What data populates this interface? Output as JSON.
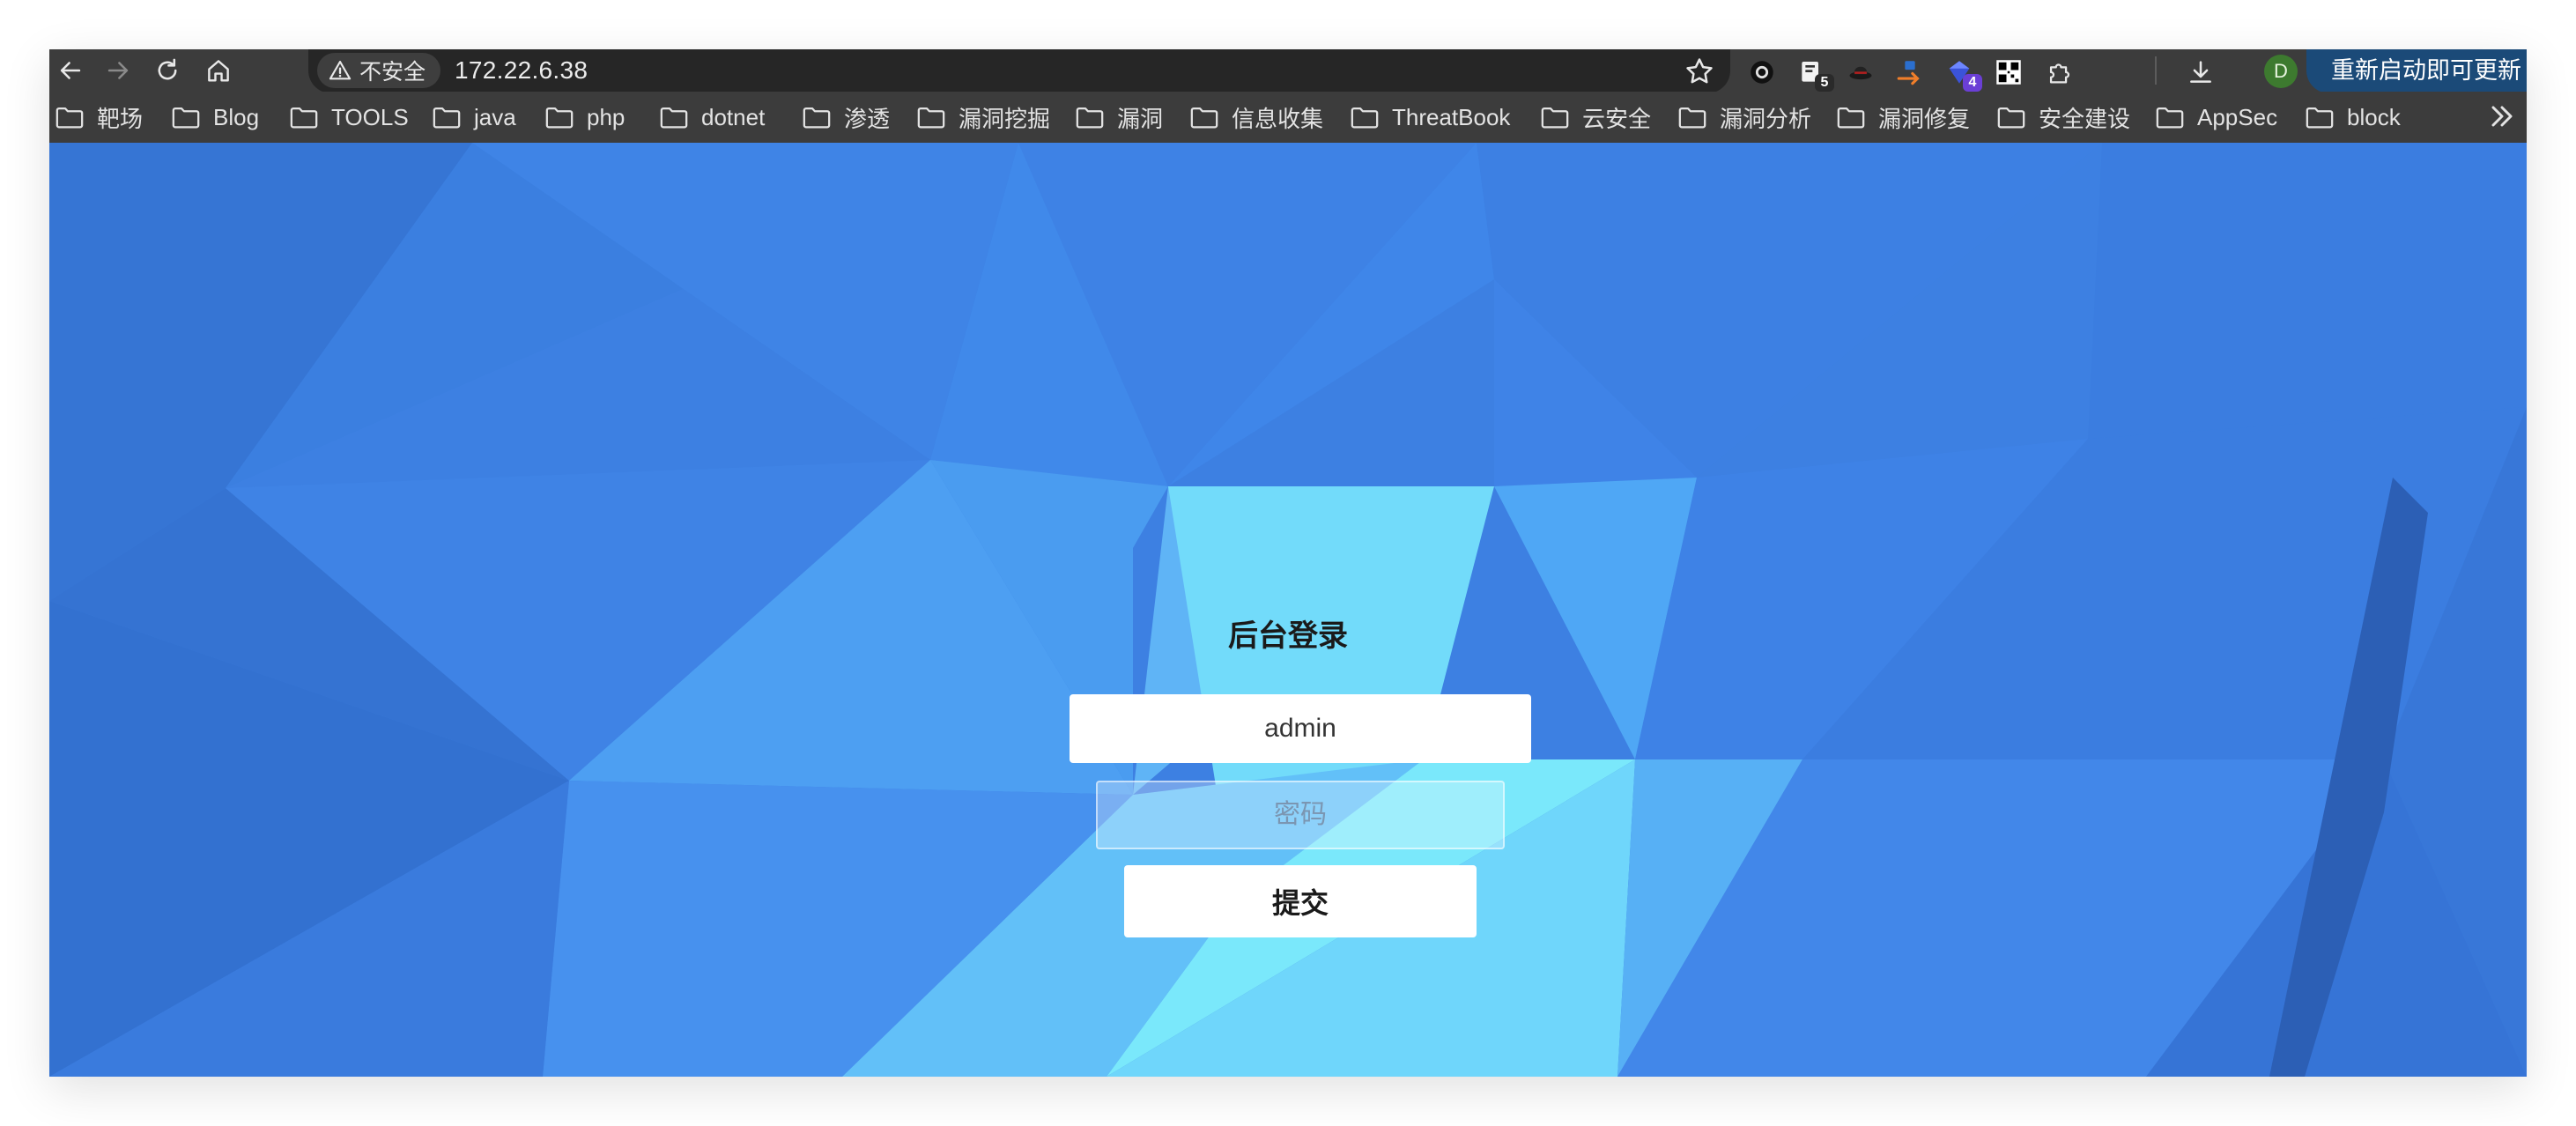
{
  "browser": {
    "security_label": "不安全",
    "url": "172.22.6.38",
    "extensions": [
      {
        "icon": "circle-record-extension-icon"
      },
      {
        "icon": "clipboard-extension-icon",
        "badge": "5",
        "badge_color": "#2a2a2a"
      },
      {
        "icon": "hat-extension-icon"
      },
      {
        "icon": "arrow-extension-icon",
        "color": "#f07e2a"
      },
      {
        "icon": "gem-extension-icon",
        "badge": "4",
        "badge_color": "#6b3fd6"
      },
      {
        "icon": "qr-extension-icon"
      },
      {
        "icon": "puzzle-extensions-icon"
      }
    ],
    "avatar_letter": "D",
    "update_label": "重新启动即可更新"
  },
  "bookmarks": [
    {
      "label": "靶场"
    },
    {
      "label": "Blog"
    },
    {
      "label": "TOOLS"
    },
    {
      "label": "java"
    },
    {
      "label": "php"
    },
    {
      "label": "dotnet"
    },
    {
      "label": "渗透"
    },
    {
      "label": "漏洞挖掘"
    },
    {
      "label": "漏洞"
    },
    {
      "label": "信息收集"
    },
    {
      "label": "ThreatBook"
    },
    {
      "label": "云安全"
    },
    {
      "label": "漏洞分析"
    },
    {
      "label": "漏洞修复"
    },
    {
      "label": "安全建设"
    },
    {
      "label": "AppSec"
    },
    {
      "label": "block"
    }
  ],
  "login": {
    "title": "后台登录",
    "username_value": "admin",
    "password_placeholder": "密码",
    "submit_label": "提交"
  },
  "colors": {
    "toolbar": "#3c3c3c",
    "background_base": "#3a7ee0",
    "background_highlight": "#7ef0fb"
  }
}
